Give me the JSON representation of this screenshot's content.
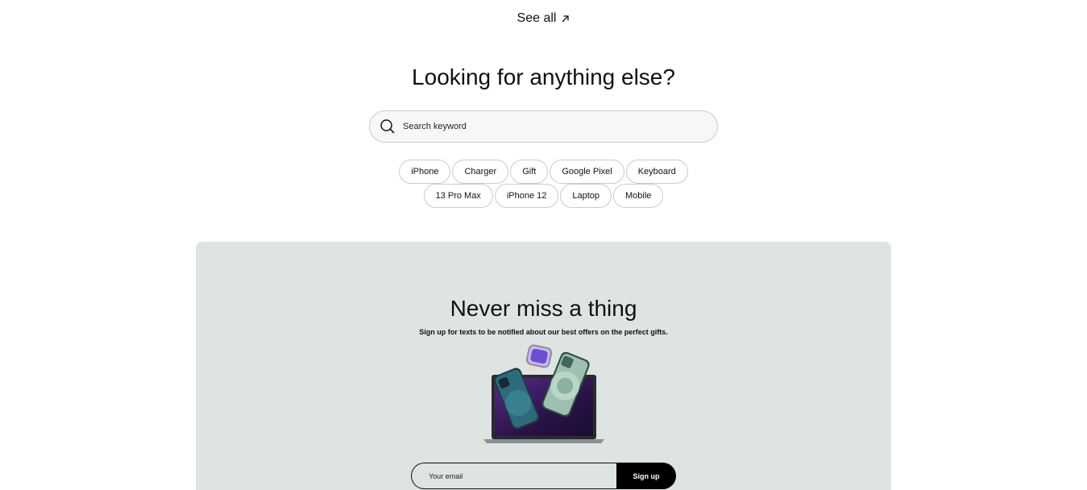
{
  "see_all": {
    "label": "See all"
  },
  "search_section": {
    "title": "Looking for anything else?",
    "search_placeholder": "Search keyword",
    "chips_row1": [
      "iPhone",
      "Charger",
      "Gift",
      "Google Pixel",
      "Keyboard"
    ],
    "chips_row2": [
      "13 Pro Max",
      "iPhone 12",
      "Laptop",
      "Mobile"
    ]
  },
  "signup": {
    "title": "Never miss a thing",
    "subtitle": "Sign up for texts to be notified about our best offers on the perfect gifts.",
    "email_placeholder": "Your email",
    "button_label": "Sign up",
    "panel_color": "#dde4e1"
  },
  "icons": {
    "see_all_arrow": "arrow-up-right-icon",
    "search": "search-icon"
  }
}
